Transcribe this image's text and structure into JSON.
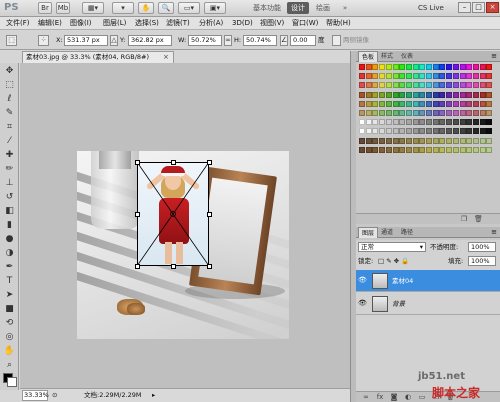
{
  "app": {
    "logo": "PS",
    "workspaces": [
      "基本功能",
      "设计",
      "绘画"
    ],
    "active_workspace": "设计",
    "cs_live_label": "CS Live",
    "window_controls": [
      "minimize",
      "restore",
      "close"
    ]
  },
  "menu": {
    "items": [
      "文件(F)",
      "编辑(E)",
      "图像(I)",
      "图层(L)",
      "选择(S)",
      "滤镜(T)",
      "分析(A)",
      "3D(D)",
      "视图(V)",
      "窗口(W)",
      "帮助(H)"
    ]
  },
  "options": {
    "x_label": "X:",
    "x_value": "531.37 px",
    "y_label": "Y:",
    "y_value": "362.82 px",
    "w_label": "W:",
    "w_value": "50.72%",
    "h_label": "H:",
    "h_value": "50.74%",
    "angle_value": "0.00",
    "angle_unit": "度",
    "interp_label": "插值",
    "commit_hint": "两侧镜像"
  },
  "document": {
    "tab_title": "素材03.jpg @ 33.3% (素材04, RGB/8#)",
    "close_glyph": "×"
  },
  "status": {
    "zoom": "33.33%",
    "doc_info": "文档:2.29M/2.29M"
  },
  "panels": {
    "top_tabs": [
      "色板",
      "样式",
      "仪表"
    ],
    "active_top_tab": "色板",
    "bottom_tabs": [
      "图层",
      "通道",
      "路径"
    ],
    "active_bottom_tab": "图层",
    "blend_mode": "正常",
    "opacity_label": "不透明度:",
    "opacity_value": "100%",
    "lock_label": "锁定:",
    "fill_label": "填充:",
    "fill_value": "100%",
    "layers": [
      {
        "name": "素材04",
        "selected": true,
        "visible": true
      },
      {
        "name": "背景",
        "selected": false,
        "visible": true
      }
    ]
  },
  "colors": {
    "accent": "#3b8de0",
    "foreground": "#000000",
    "background": "#ffffff"
  },
  "watermark": {
    "line1": "jb51.net",
    "line2": "脚本之家"
  }
}
